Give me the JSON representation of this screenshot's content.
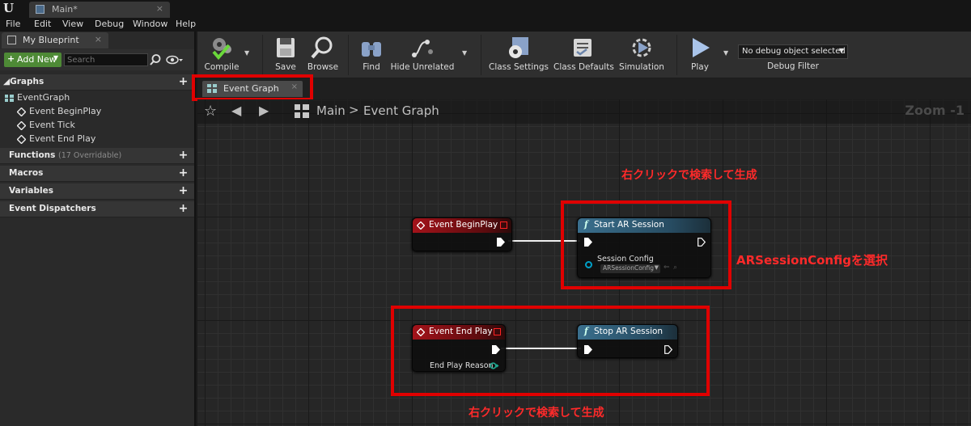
{
  "window": {
    "tab_title": "Main*",
    "menu": [
      "File",
      "Edit",
      "View",
      "Debug",
      "Window",
      "Help"
    ]
  },
  "left_panel": {
    "tab_label": "My Blueprint",
    "add_new_label": "Add New",
    "search_placeholder": "Search",
    "sections": {
      "graphs": "Graphs",
      "functions": "Functions",
      "functions_sub": "(17 Overridable)",
      "macros": "Macros",
      "variables": "Variables",
      "event_dispatchers": "Event Dispatchers"
    },
    "tree": {
      "event_graph": "EventGraph",
      "items": [
        "Event BeginPlay",
        "Event Tick",
        "Event End Play"
      ]
    }
  },
  "toolbar": {
    "compile": "Compile",
    "save": "Save",
    "browse": "Browse",
    "find": "Find",
    "hide_unrelated": "Hide Unrelated",
    "class_settings": "Class Settings",
    "class_defaults": "Class Defaults",
    "simulation": "Simulation",
    "play": "Play",
    "debug_object": "No debug object selected",
    "debug_filter": "Debug Filter"
  },
  "graph_tab": {
    "label": "Event Graph"
  },
  "breadcrumb": {
    "root": "Main",
    "separator": ">",
    "current": "Event Graph"
  },
  "zoom": "Zoom -1",
  "nodes": {
    "begin_play": {
      "title": "Event BeginPlay"
    },
    "start_ar": {
      "title": "Start AR Session",
      "pin_label": "Session Config",
      "pin_value": "ARSessionConfig"
    },
    "end_play": {
      "title": "Event End Play",
      "pin_label": "End Play Reason"
    },
    "stop_ar": {
      "title": "Stop AR Session"
    }
  },
  "annotations": {
    "top": "右クリックで検索して生成",
    "right": "ARSessionConfigを選択",
    "bottom": "右クリックで検索して生成"
  },
  "colors": {
    "highlight_red": "#e00000",
    "annotation_red": "#ff2a2a",
    "event_header": "#a3131a",
    "function_header": "#3a6f8d",
    "add_new_green": "#4e8a36"
  }
}
